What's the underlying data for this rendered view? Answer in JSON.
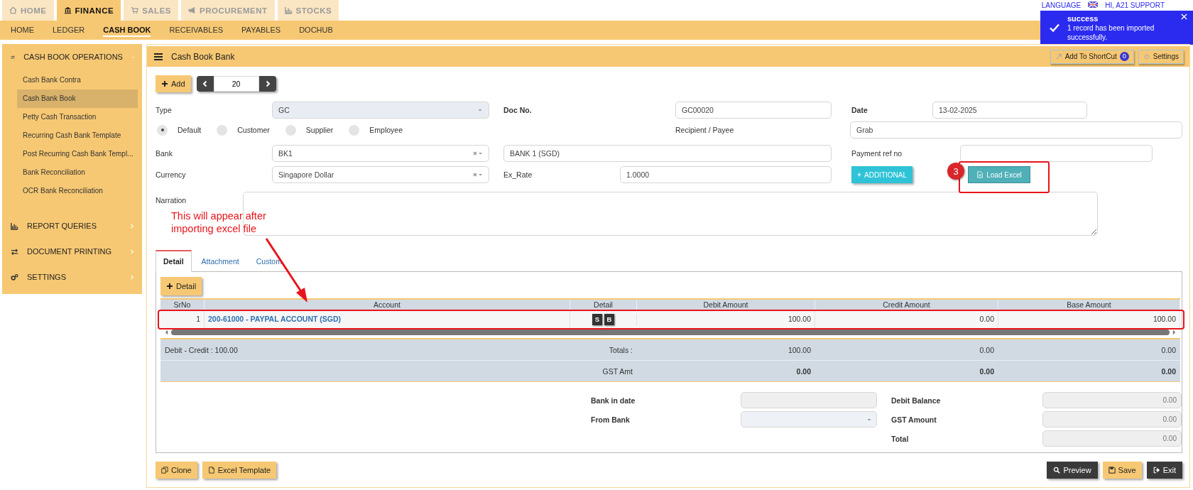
{
  "top_tabs": [
    {
      "label": "HOME",
      "selected": false
    },
    {
      "label": "FINANCE",
      "selected": true
    },
    {
      "label": "SALES",
      "selected": false
    },
    {
      "label": "PROCUREMENT",
      "selected": false
    },
    {
      "label": "STOCKS",
      "selected": false
    }
  ],
  "subnav": [
    {
      "label": "HOME",
      "selected": false
    },
    {
      "label": "LEDGER",
      "selected": false
    },
    {
      "label": "CASH BOOK",
      "selected": true
    },
    {
      "label": "RECEIVABLES",
      "selected": false
    },
    {
      "label": "PAYABLES",
      "selected": false
    },
    {
      "label": "DOCHUB",
      "selected": false
    }
  ],
  "header_right": {
    "language": "LANGUAGE",
    "greeting": "HI, A21 SUPPORT"
  },
  "toast": {
    "title": "success",
    "message": "1 record has been imported successfully."
  },
  "sidebar": {
    "sections": [
      {
        "title": "CASH BOOK OPERATIONS",
        "expanded": true,
        "items": [
          {
            "label": "Cash Bank Contra",
            "selected": false
          },
          {
            "label": "Cash Bank Book",
            "selected": true
          },
          {
            "label": "Petty Cash Transaction",
            "selected": false
          },
          {
            "label": "Recurring Cash Bank Template",
            "selected": false
          },
          {
            "label": "Post Recurring Cash Bank Templ...",
            "selected": false
          },
          {
            "label": "Bank Reconciliation",
            "selected": false
          },
          {
            "label": "OCR Bank Reconciliation",
            "selected": false
          }
        ]
      },
      {
        "title": "REPORT QUERIES",
        "expanded": false
      },
      {
        "title": "DOCUMENT PRINTING",
        "expanded": false
      },
      {
        "title": "SETTINGS",
        "expanded": false
      }
    ]
  },
  "page": {
    "title": "Cash Book Bank",
    "shortcut_button": "Add To ShortCut",
    "shortcut_count": "0",
    "settings_button": "Settings"
  },
  "toolbar": {
    "add_button": "Add",
    "record_number": "20"
  },
  "form": {
    "type_label": "Type",
    "type_value": "GC",
    "doc_no_label": "Doc No.",
    "doc_no_value": "GC00020",
    "date_label": "Date",
    "date_value": "13-02-2025",
    "party_types": [
      {
        "label": "Default",
        "selected": true
      },
      {
        "label": "Customer",
        "selected": false
      },
      {
        "label": "Supplier",
        "selected": false
      },
      {
        "label": "Employee",
        "selected": false
      }
    ],
    "recipient_label": "Recipient / Payee",
    "recipient_value": "Grab",
    "bank_label": "Bank",
    "bank_value": "BK1",
    "bank_name": "BANK 1 (SGD)",
    "payment_ref_label": "Payment ref no",
    "currency_label": "Currency",
    "currency_value": "Singapore Dollar",
    "ex_rate_label": "Ex_Rate",
    "ex_rate_value": "1.0000",
    "additional_button": "ADDITIONAL",
    "load_excel_button": "Load Excel",
    "narration_label": "Narration"
  },
  "annotation": {
    "step": "3",
    "note": "This will appear after importing excel file"
  },
  "detail_tabs": [
    {
      "label": "Detail",
      "selected": true
    },
    {
      "label": "Attachment",
      "selected": false
    },
    {
      "label": "Custom",
      "selected": false
    }
  ],
  "detail": {
    "add_button": "Detail",
    "columns": [
      "SrNo",
      "Account",
      "Detail",
      "Debit Amount",
      "Credit Amount",
      "Base Amount"
    ],
    "rows": [
      {
        "srno": "1",
        "account": "200-61000 - PAYPAL ACCOUNT (SGD)",
        "badges": [
          "S",
          "B"
        ],
        "debit": "100.00",
        "credit": "0.00",
        "base": "100.00"
      }
    ],
    "difference": "Debit - Credit : 100.00",
    "totals_label": "Totals :",
    "totals": [
      "100.00",
      "0.00",
      "0.00"
    ],
    "gst_label": "GST Amt",
    "gst": [
      "0.00",
      "0.00",
      "0.00"
    ]
  },
  "footer_fields": {
    "left": [
      {
        "label": "Bank in date",
        "kind": "input"
      },
      {
        "label": "From Bank",
        "kind": "select"
      }
    ],
    "right": [
      {
        "label": "Debit Balance",
        "value": "0.00"
      },
      {
        "label": "GST Amount",
        "value": "0.00"
      },
      {
        "label": "Total",
        "value": "0.00"
      }
    ]
  },
  "buttons": {
    "left": [
      "Clone",
      "Excel Template"
    ],
    "right": [
      {
        "label": "Preview",
        "kind": "dark"
      },
      {
        "label": "Save",
        "kind": "primary"
      },
      {
        "label": "Exit",
        "kind": "dark"
      }
    ]
  }
}
